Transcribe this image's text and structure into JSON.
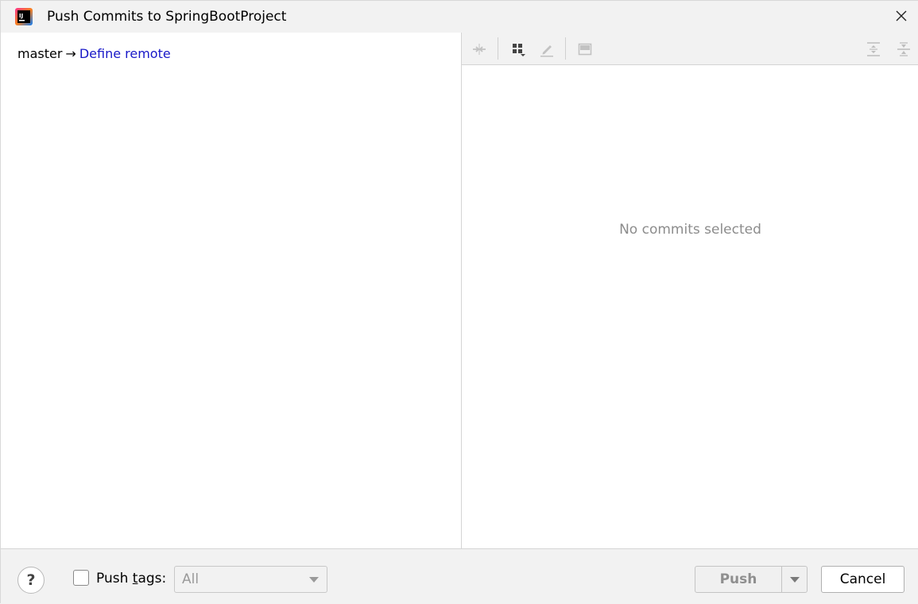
{
  "window": {
    "title": "Push Commits to SpringBootProject"
  },
  "left_panel": {
    "branch": "master",
    "arrow": "→",
    "remote_link": "Define remote"
  },
  "right_panel": {
    "toolbar": {
      "icons": [
        "collapse-icon",
        "group-by-icon",
        "edit-icon",
        "preview-icon",
        "expand-all-icon",
        "collapse-all-icon"
      ]
    },
    "empty_text": "No commits selected"
  },
  "bottom_bar": {
    "help_label": "?",
    "push_tags_prefix": "Push ",
    "push_tags_mnemonic": "t",
    "push_tags_suffix": "ags:",
    "push_tags_checked": false,
    "tags_select_value": "All",
    "push_label": "Push",
    "cancel_label": "Cancel"
  },
  "colors": {
    "link": "#1818c8",
    "background": "#f2f2f2",
    "panel": "#ffffff",
    "muted_text": "#8c8c8c"
  }
}
